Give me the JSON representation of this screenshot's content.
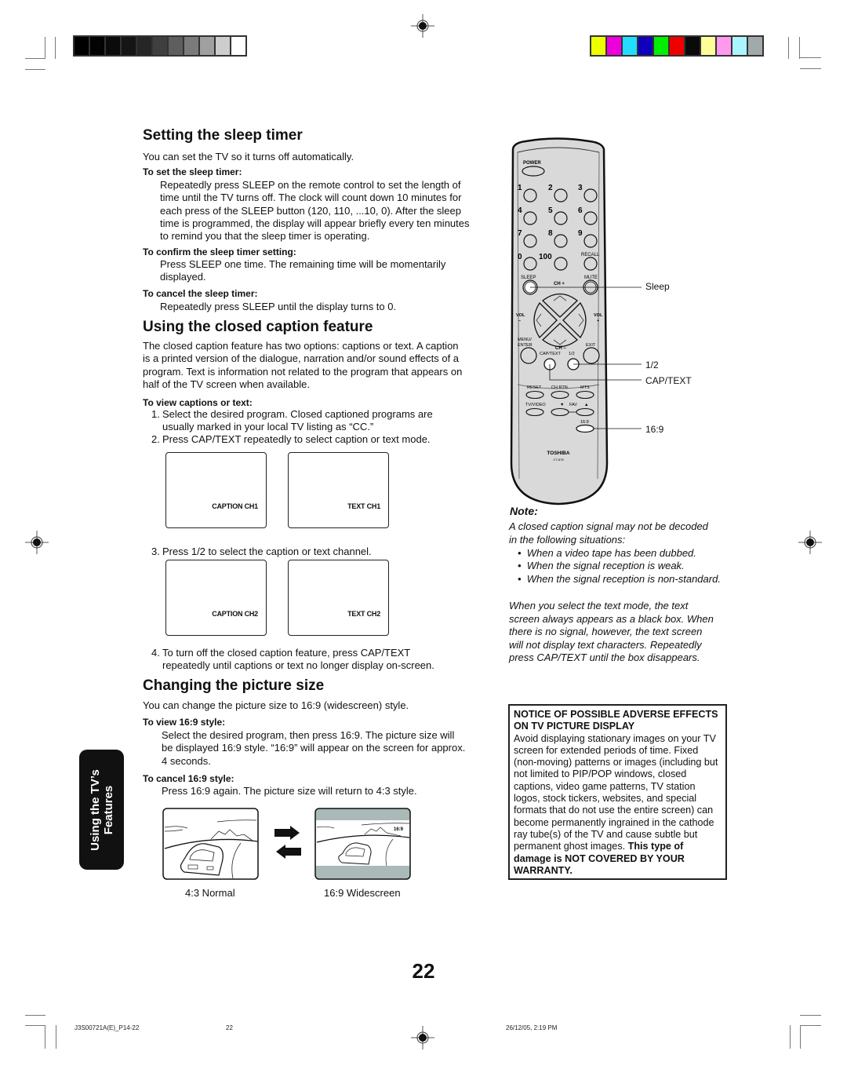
{
  "colors": {
    "gray_scale": [
      "#000000",
      "#030303",
      "#0b0b0b",
      "#151515",
      "#262626",
      "#3f3f3f",
      "#5e5e5e",
      "#7b7b7b",
      "#a0a0a0",
      "#cdcdcd",
      "#ffffff"
    ],
    "color_bars": [
      "#eeff00",
      "#ee00dd",
      "#22ddff",
      "#1100bb",
      "#00ee00",
      "#ee0000",
      "#0a0a0a",
      "#ffff99",
      "#ff99ee",
      "#aaf5ff",
      "#a0aaaa"
    ]
  },
  "sleep": {
    "title": "Setting the sleep timer",
    "intro": "You can set the TV so it turns off automatically.",
    "set_heading": "To set the sleep timer:",
    "set_lines": [
      "Repeatedly press SLEEP on the remote control to set the length of",
      "time until the TV turns off. The clock will count down 10 minutes for",
      "each press of the SLEEP button (120, 110, ...10, 0). After the sleep",
      "time is programmed, the display will appear briefly every ten minutes",
      "to remind you that the sleep timer is operating."
    ],
    "confirm_heading": "To confirm the sleep timer setting:",
    "confirm_lines": [
      "Press SLEEP one time. The remaining time will be momentarily",
      "displayed."
    ],
    "cancel_heading": "To cancel the sleep timer:",
    "cancel_text": "Repeatedly press SLEEP until the display turns to 0."
  },
  "cc": {
    "title": "Using the closed caption feature",
    "intro_lines": [
      "The closed caption feature has two options: captions or text. A caption",
      "is a printed version of the dialogue, narration and/or sound effects of a",
      "program. Text is information not related to the program that appears on",
      "half of the TV screen when available."
    ],
    "view_heading": "To view captions or text:",
    "steps": [
      {
        "num": "1.",
        "lines": [
          "Select the desired program. Closed captioned programs are",
          "usually marked in your local TV listing as “CC.”"
        ]
      },
      {
        "num": "2.",
        "lines": [
          "Press CAP/TEXT repeatedly to select caption or text mode."
        ]
      },
      {
        "num": "3.",
        "lines": [
          "Press 1/2 to select the caption or text channel."
        ]
      },
      {
        "num": "4.",
        "lines": [
          "To turn off the closed caption feature, press CAP/TEXT",
          "repeatedly until captions or text no longer display on-screen."
        ]
      }
    ],
    "screens_row1": [
      "CAPTION CH1",
      "TEXT CH1"
    ],
    "screens_row2": [
      "CAPTION CH2",
      "TEXT CH2"
    ]
  },
  "picture": {
    "title": "Changing the picture size",
    "intro": "You can change the picture size to 16:9 (widescreen) style.",
    "view_heading": "To view 16:9 style:",
    "view_lines": [
      "Select the desired program, then press 16:9. The picture size will",
      "be displayed 16:9 style. “16:9” will appear on the screen for approx.",
      "4 seconds."
    ],
    "cancel_heading": "To cancel 16:9 style:",
    "cancel_text": "Press 16:9 again. The picture size will return to 4:3 style.",
    "caption_normal": "4:3 Normal",
    "caption_wide": "16:9 Widescreen",
    "wide_overlay": "16:9"
  },
  "side_tab": {
    "line1": "Using the TV’s",
    "line2": "Features"
  },
  "remote": {
    "power": "POWER",
    "digits": [
      "1",
      "2",
      "3",
      "4",
      "5",
      "6",
      "7",
      "8",
      "9",
      "0",
      "100"
    ],
    "recall": "RECALL",
    "sleep": "SLEEP",
    "mute": "MUTE",
    "ch_plus": "CH +",
    "ch_minus": "CH –",
    "vol": "VOL",
    "minus": "–",
    "plus": "+",
    "menu": "MENU/",
    "enter": "ENTER",
    "exit": "EXIT",
    "captext": "CAP/TEXT",
    "half": "1/2",
    "reset": "RESET",
    "chrtn": "CH RTN",
    "mts": "MTS",
    "tvvideo": "TV/VIDEO",
    "fav": "FAV",
    "fav_down": "▼",
    "fav_up": "▲",
    "aspect": "16:9",
    "brand": "TOSHIBA",
    "model": "CT-878",
    "callouts": {
      "sleep": "Sleep",
      "half": "1/2",
      "captext": "CAP/TEXT",
      "aspect": "16:9"
    }
  },
  "note": {
    "title": "Note:",
    "intro_lines": [
      "A closed caption signal may not be decoded",
      "in the following situations:"
    ],
    "bullets": [
      "When a video tape has been dubbed.",
      "When the signal reception is weak.",
      "When the signal reception is non-standard."
    ],
    "text_mode_lines": [
      "When you select the text mode, the text",
      "screen always appears as a black box. When",
      "there is no signal, however, the text screen",
      "will not display text characters. Repeatedly",
      "press CAP/TEXT until the box disappears."
    ]
  },
  "notice": {
    "heading": "NOTICE OF POSSIBLE ADVERSE EFFECTS ON TV PICTURE DISPLAY",
    "body": "Avoid displaying stationary images on your TV screen for extended periods of time. Fixed (non-moving) patterns or images (including but not limited to PIP/POP windows, closed captions, video game patterns, TV station logos, stock tickers, websites, and special formats that do not use the entire screen) can become permanently ingrained in the cathode ray tube(s) of the TV and cause subtle but permanent ghost images.",
    "warning": "This type of damage is NOT COVERED BY YOUR WARRANTY."
  },
  "page_number": "22",
  "footer": {
    "file": "J3S00721A(E)_P14-22",
    "page": "22",
    "date": "26/12/05, 2:19 PM"
  }
}
